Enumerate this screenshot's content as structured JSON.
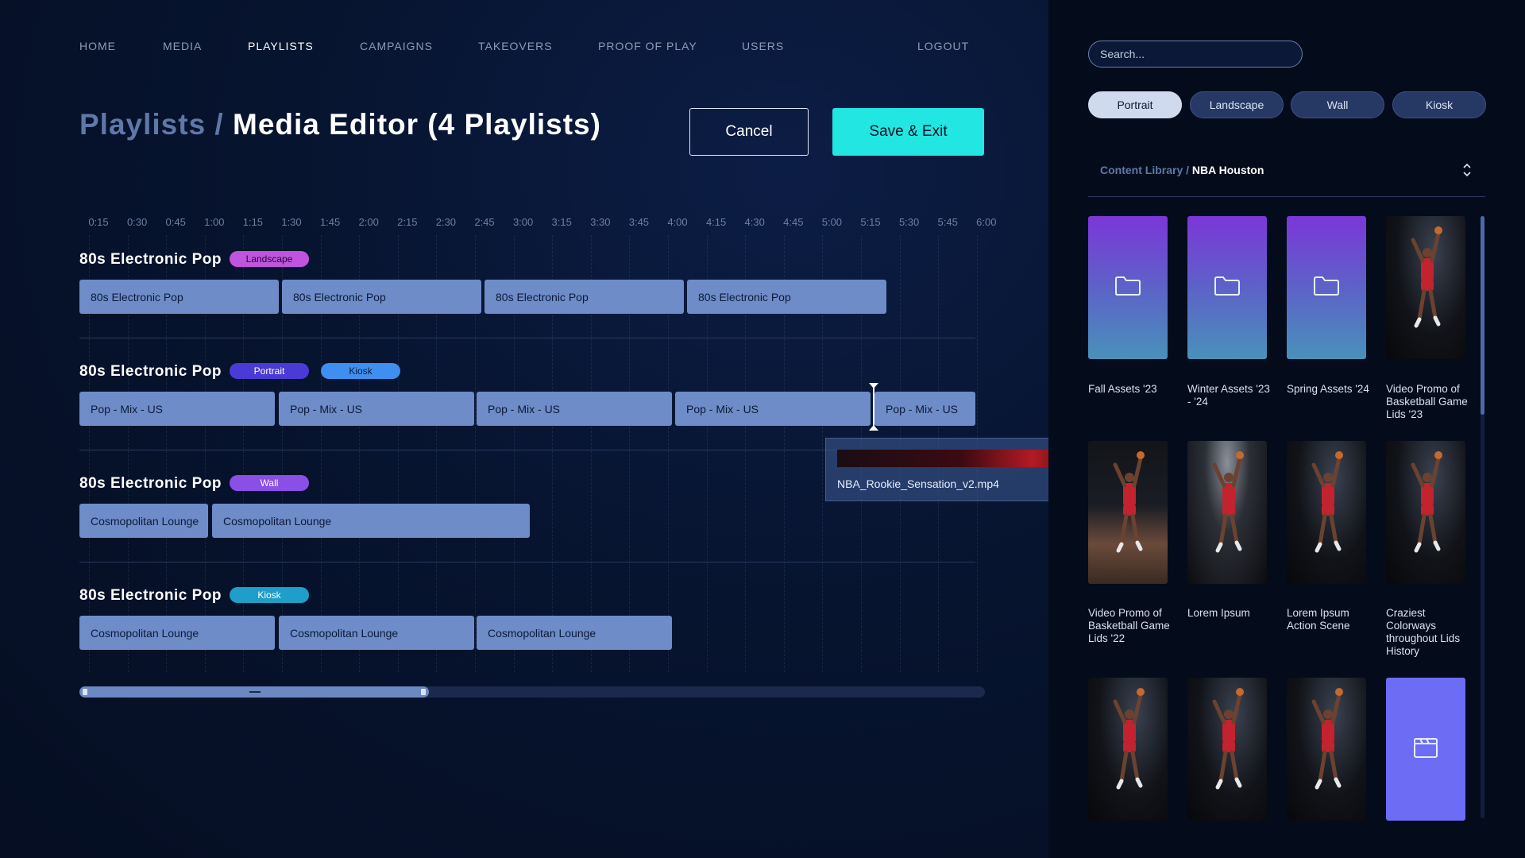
{
  "nav": {
    "items": [
      {
        "label": "HOME"
      },
      {
        "label": "MEDIA"
      },
      {
        "label": "PLAYLISTS",
        "active": true
      },
      {
        "label": "CAMPAIGNS"
      },
      {
        "label": "TAKEOVERS"
      },
      {
        "label": "PROOF OF PLAY"
      },
      {
        "label": "USERS"
      }
    ],
    "logout": "LOGOUT"
  },
  "header": {
    "crumb_parent": "Playlists /",
    "crumb_current": "Media Editor (4 Playlists)",
    "cancel_label": "Cancel",
    "save_label": "Save & Exit"
  },
  "timeline": {
    "ticks": [
      "0:15",
      "0:30",
      "0:45",
      "1:00",
      "1:15",
      "1:30",
      "1:45",
      "2:00",
      "2:15",
      "2:30",
      "2:45",
      "3:00",
      "3:15",
      "3:30",
      "3:45",
      "4:00",
      "4:15",
      "4:30",
      "4:45",
      "5:00",
      "5:15",
      "5:30",
      "5:45",
      "6:00"
    ],
    "rows": [
      {
        "title": "80s Electronic Pop",
        "tags": [
          {
            "label": "Landscape",
            "color": "#c054df",
            "text_color": "#1a0b2e"
          }
        ],
        "clips": [
          "80s Electronic Pop",
          "80s Electronic Pop",
          "80s Electronic Pop",
          "80s Electronic Pop"
        ]
      },
      {
        "title": "80s Electronic Pop",
        "tags": [
          {
            "label": "Portrait",
            "color": "#4a3bd6",
            "text_color": "#ffffff"
          },
          {
            "label": "Kiosk",
            "color": "#3f8ff0",
            "text_color": "#0b1a38"
          }
        ],
        "clips": [
          "Pop - Mix - US",
          "Pop - Mix - US",
          "Pop - Mix - US",
          "Pop - Mix - US",
          "Pop - Mix - US"
        ]
      },
      {
        "title": "80s Electronic Pop",
        "tags": [
          {
            "label": "Wall",
            "color": "#8a4fe6",
            "text_color": "#ffffff"
          }
        ],
        "clips": [
          "Cosmopolitan Lounge",
          "Cosmopolitan Lounge"
        ]
      },
      {
        "title": "80s Electronic Pop",
        "tags": [
          {
            "label": "Kiosk",
            "color": "#1e9ec9",
            "text_color": "#ffffff"
          }
        ],
        "clips": [
          "Cosmopolitan Lounge",
          "Cosmopolitan Lounge",
          "Cosmopolitan Lounge"
        ]
      }
    ],
    "dragging_file": "NBA_Rookie_Sensation_v2.mp4"
  },
  "panel": {
    "search_placeholder": "Search...",
    "filters": [
      {
        "label": "Portrait",
        "active": true
      },
      {
        "label": "Landscape"
      },
      {
        "label": "Wall"
      },
      {
        "label": "Kiosk"
      }
    ],
    "library_parent": "Content Library /",
    "library_current": "NBA Houston",
    "tiles": [
      {
        "kind": "folder",
        "label": "Fall Assets '23"
      },
      {
        "kind": "folder",
        "label": "Winter Assets '23 - '24"
      },
      {
        "kind": "folder",
        "label": "Spring Assets '24"
      },
      {
        "kind": "photo",
        "style": "dark",
        "label": "Video Promo of Basketball Game Lids '23"
      },
      {
        "kind": "photo",
        "style": "crowd",
        "label": "Video Promo of Basketball Game Lids '22"
      },
      {
        "kind": "photo",
        "style": "spot",
        "label": "Lorem Ipsum"
      },
      {
        "kind": "photo",
        "style": "dark",
        "label": "Lorem Ipsum Action Scene"
      },
      {
        "kind": "photo",
        "style": "dark",
        "label": "Craziest Colorways throughout Lids History"
      },
      {
        "kind": "photo",
        "style": "dark",
        "label": ""
      },
      {
        "kind": "photo",
        "style": "dark",
        "label": ""
      },
      {
        "kind": "photo",
        "style": "dark",
        "label": ""
      },
      {
        "kind": "video",
        "label": ""
      }
    ]
  }
}
